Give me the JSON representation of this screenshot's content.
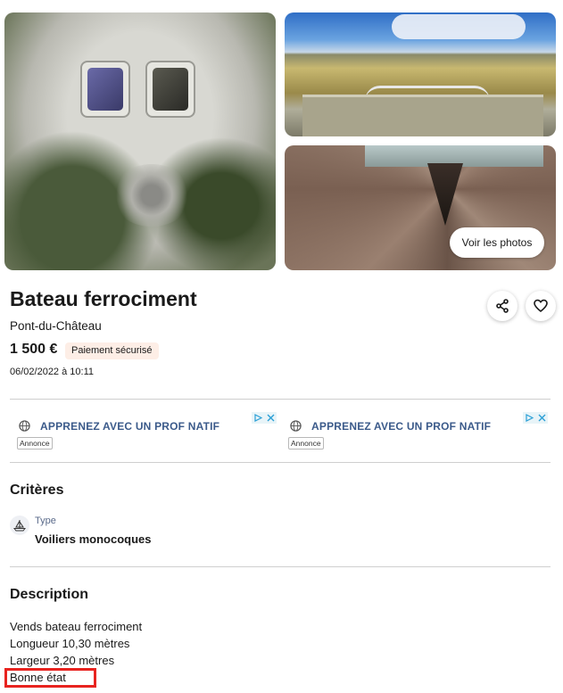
{
  "gallery": {
    "view_photos_label": "Voir les photos"
  },
  "listing": {
    "title": "Bateau ferrociment",
    "location": "Pont-du-Château",
    "price": "1 500 €",
    "payment_badge": "Paiement sécurisé",
    "date": "06/02/2022 à 10:11"
  },
  "actions": {
    "share_icon": "share-icon",
    "favorite_icon": "heart-icon"
  },
  "ads": [
    {
      "text": "APPRENEZ AVEC UN PROF NATIF",
      "label": "Annonce"
    },
    {
      "text": "APPRENEZ AVEC UN PROF NATIF",
      "label": "Annonce"
    }
  ],
  "criteria": {
    "title": "Critères",
    "type_label": "Type",
    "type_value": "Voiliers monocoques"
  },
  "description": {
    "title": "Description",
    "lines": [
      "Vends bateau ferrociment",
      "Longueur 10,30 mètres",
      "Largeur 3,20 mètres",
      "Bonne état"
    ]
  },
  "colors": {
    "highlight": "#e8231f",
    "badge_background": "#fdeee6",
    "ad_text": "#3b5a8a"
  }
}
